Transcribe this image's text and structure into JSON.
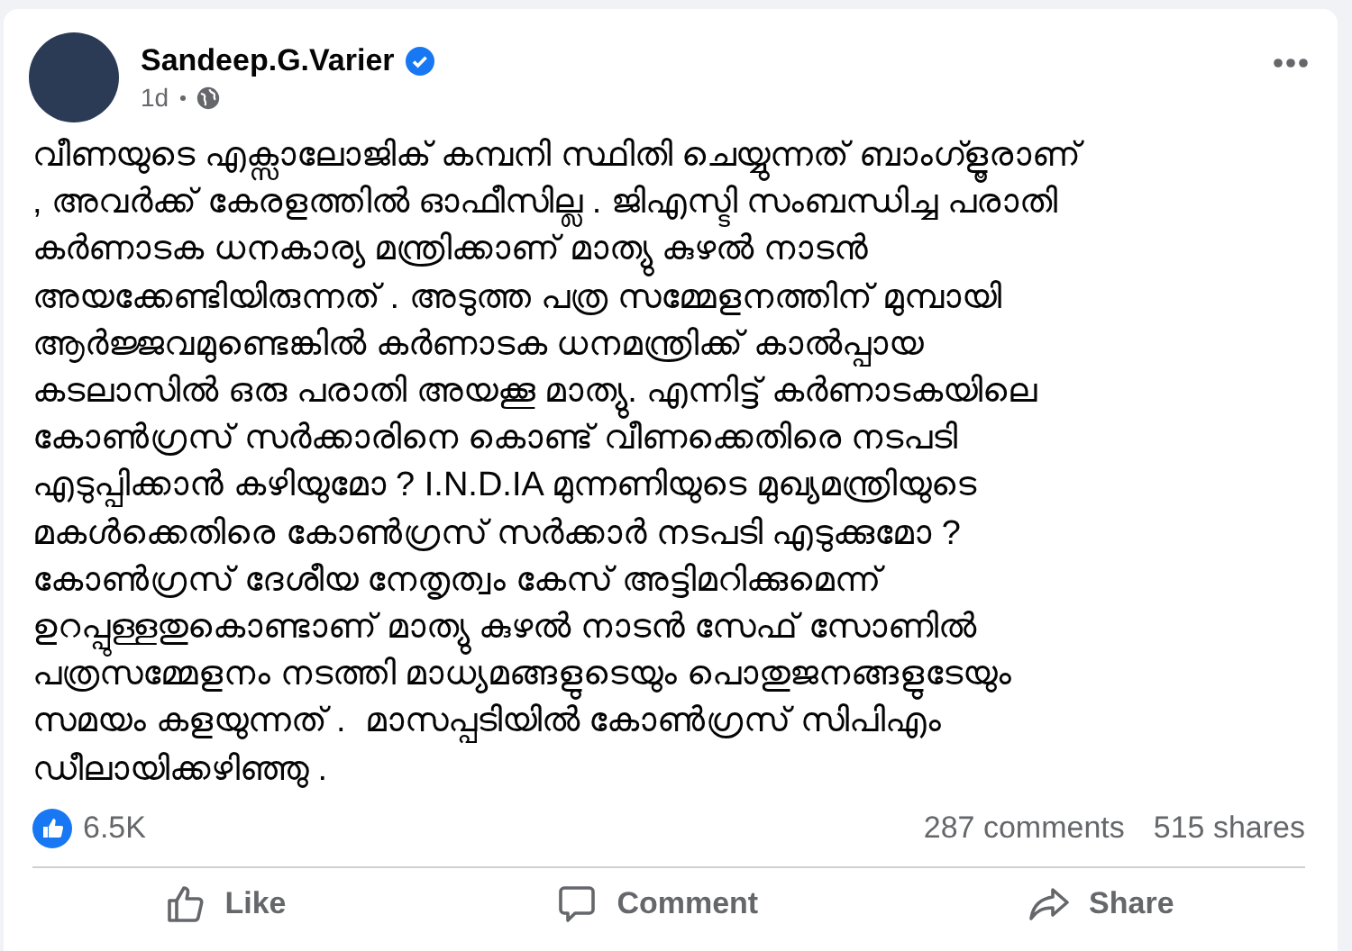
{
  "post": {
    "author": "Sandeep.G.Varier",
    "verified": true,
    "time": "1d",
    "body_lines": [
      "വീണയുടെ എക്സാലോജിക് കമ്പനി സ്ഥിതി ചെയ്യുന്നത് ബാംഗ്ളൂരാണ്",
      ", അവർക്ക് കേരളത്തിൽ ഓഫീസില്ല . ജിഎസ്ടി സംബന്ധിച്ച പരാതി",
      "കർണാടക ധനകാര്യ മന്ത്രിക്കാണ് മാത്യു കുഴൽ നാടൻ",
      "അയക്കേണ്ടിയിരുന്നത് . അടുത്ത പത്ര സമ്മേളനത്തിന് മുമ്പായി",
      "ആർജ്ജവമുണ്ടെങ്കിൽ കർണാടക ധനമന്ത്രിക്ക് കാൽപ്പായ",
      "കടലാസിൽ ഒരു പരാതി അയക്കൂ മാത്യു. എന്നിട്ട് കർണാടകയിലെ",
      "കോൺഗ്രസ് സർക്കാരിനെ കൊണ്ട് വീണക്കെതിരെ നടപടി",
      "എടുപ്പിക്കാൻ കഴിയുമോ ? I.N.D.IA മുന്നണിയുടെ മുഖ്യമന്ത്രിയുടെ",
      "മകൾക്കെതിരെ കോൺഗ്രസ് സർക്കാർ നടപടി എടുക്കുമോ ?",
      "കോൺഗ്രസ് ദേശീയ നേതൃത്വം കേസ് അട്ടിമറിക്കുമെന്ന്",
      "ഉറപ്പുള്ളതുകൊണ്ടാണ് മാത്യു കുഴൽ നാടൻ സേഫ് സോണിൽ",
      "പത്രസമ്മേളനം നടത്തി മാധ്യമങ്ങളുടെയും പൊതുജനങ്ങളുടേയും",
      "സമയം കളയുന്നത് .  മാസപ്പടിയിൽ കോൺഗ്രസ് സിപിഎം",
      "ഡീലായിക്കഴിഞ്ഞു ."
    ],
    "reactions": "6.5K",
    "comments": "287 comments",
    "shares": "515 shares",
    "actions": [
      {
        "kind": "like",
        "label": "Like"
      },
      {
        "kind": "comment",
        "label": "Comment"
      },
      {
        "kind": "share",
        "label": "Share"
      }
    ]
  }
}
